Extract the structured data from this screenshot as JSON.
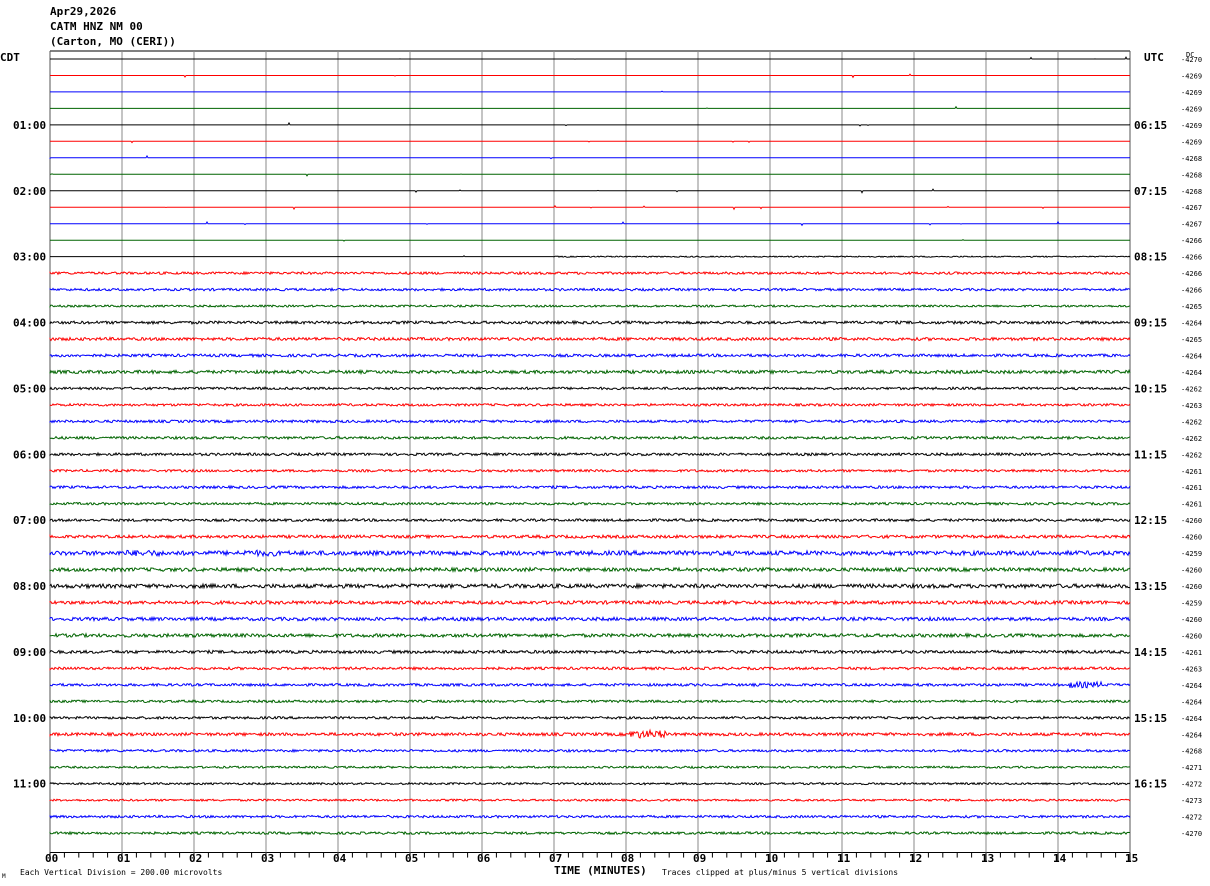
{
  "header": {
    "date": "Apr29,2026",
    "station": "CATM HNZ NM 00",
    "location": "(Carton, MO (CERI))",
    "left_tz": "CDT",
    "right_tz": "UTC",
    "dc_label": "DC"
  },
  "footer": {
    "scale_note": "Each Vertical Division =  200.00 microvolts",
    "xlabel": "TIME (MINUTES)",
    "clip_note": "Traces clipped at plus/minus 5 vertical divisions",
    "corner_mark": "M"
  },
  "chart_data": {
    "type": "line",
    "title": "CATM HNZ NM 00 helicorder",
    "xlabel": "TIME (MINUTES)",
    "xlim": [
      0,
      15
    ],
    "x_ticks": [
      "00",
      "01",
      "02",
      "03",
      "04",
      "05",
      "06",
      "07",
      "08",
      "09",
      "10",
      "11",
      "12",
      "13",
      "14",
      "15"
    ],
    "trace_minutes": 15,
    "colors": [
      "#000000",
      "#ff0000",
      "#0000ff",
      "#006400"
    ],
    "left_labels": [
      "",
      "",
      "",
      "",
      "01:00",
      "",
      "",
      "",
      "02:00",
      "",
      "",
      "",
      "03:00",
      "",
      "",
      "",
      "04:00",
      "",
      "",
      "",
      "05:00",
      "",
      "",
      "",
      "06:00",
      "",
      "",
      "",
      "07:00",
      "",
      "",
      "",
      "08:00",
      "",
      "",
      "",
      "09:00",
      "",
      "",
      "",
      "10:00",
      "",
      "",
      "",
      "11:00",
      "",
      "",
      ""
    ],
    "right_labels": [
      "",
      "",
      "",
      "",
      "06:15",
      "",
      "",
      "",
      "07:15",
      "",
      "",
      "",
      "08:15",
      "",
      "",
      "",
      "09:15",
      "",
      "",
      "",
      "10:15",
      "",
      "",
      "",
      "11:15",
      "",
      "",
      "",
      "12:15",
      "",
      "",
      "",
      "13:15",
      "",
      "",
      "",
      "14:15",
      "",
      "",
      "",
      "15:15",
      "",
      "",
      "",
      "16:15",
      "",
      "",
      ""
    ],
    "dc_offsets": [
      "-4270",
      "-4269",
      "-4269",
      "-4269",
      "-4269",
      "-4269",
      "-4268",
      "-4268",
      "-4268",
      "-4267",
      "-4267",
      "-4266",
      "-4266",
      "-4266",
      "-4266",
      "-4265",
      "-4264",
      "-4265",
      "-4264",
      "-4264",
      "-4262",
      "-4263",
      "-4262",
      "-4262",
      "-4262",
      "-4261",
      "-4261",
      "-4261",
      "-4260",
      "-4260",
      "-4259",
      "-4260",
      "-4260",
      "-4259",
      "-4260",
      "-4260",
      "-4261",
      "-4263",
      "-4264",
      "-4264",
      "-4264",
      "-4264",
      "-4268",
      "-4271",
      "-4272",
      "-4273",
      "-4272",
      "-4270"
    ],
    "noise_level": [
      0.2,
      0.2,
      0.3,
      0.3,
      0.2,
      0.2,
      0.2,
      0.2,
      0.2,
      0.2,
      0.2,
      0.2,
      0.6,
      1.2,
      1.2,
      1.0,
      1.4,
      1.5,
      1.4,
      1.6,
      1.2,
      1.2,
      1.3,
      1.3,
      1.3,
      1.2,
      1.3,
      1.2,
      1.3,
      1.5,
      2.2,
      1.8,
      2.0,
      1.7,
      1.7,
      1.7,
      1.5,
      1.3,
      1.3,
      1.2,
      1.2,
      1.5,
      1.2,
      1.0,
      1.0,
      1.0,
      1.2,
      1.2
    ],
    "active_from_minute": [
      15,
      15,
      15,
      15,
      15,
      15,
      15,
      15,
      15,
      15,
      15,
      15,
      7,
      0,
      0,
      0,
      0,
      0,
      0,
      0,
      0,
      0,
      0,
      0,
      0,
      0,
      0,
      0,
      0,
      0,
      0,
      0,
      0,
      0,
      0,
      0,
      0,
      0,
      0,
      0,
      0,
      0,
      0,
      0,
      0,
      0,
      0,
      0
    ],
    "events": [
      {
        "trace": 41,
        "minute": 8.3,
        "amplitude": 4
      },
      {
        "trace": 30,
        "minute": 1.3,
        "amplitude": 3
      },
      {
        "trace": 30,
        "minute": 2.9,
        "amplitude": 3
      },
      {
        "trace": 38,
        "minute": 14.4,
        "amplitude": 3
      }
    ]
  }
}
